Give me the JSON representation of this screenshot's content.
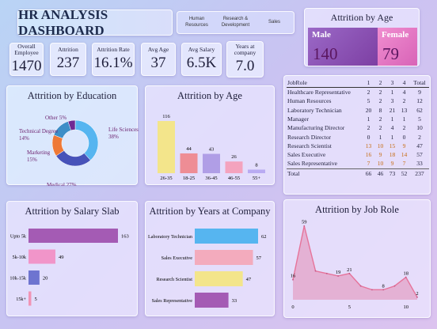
{
  "header": {
    "title": "HR ANALYSIS DASHBOARD",
    "nav": [
      "Human Resources",
      "Research & Development",
      "Sales"
    ]
  },
  "kpis": [
    {
      "label": "Overall Employee",
      "value": "1470"
    },
    {
      "label": "Attrition",
      "value": "237"
    },
    {
      "label": "Attrition Rate",
      "value": "16.1%"
    },
    {
      "label": "Avg Age",
      "value": "37"
    },
    {
      "label": "Avg Salary",
      "value": "6.5K"
    },
    {
      "label": "Years at company",
      "value": "7.0"
    }
  ],
  "gender": {
    "title": "Attrition by Age",
    "male_label": "Male",
    "male_value": "140",
    "female_label": "Female",
    "female_value": "79"
  },
  "colors": {
    "yellow": "#f3e58b",
    "pink": "#f4a3be",
    "lavender": "#b09ee6",
    "blue": "#56b5f0",
    "purple": "#a45bb4",
    "navy": "#4752b9",
    "orange": "#ee7937",
    "teal": "#3d8ec7",
    "violet": "#6f2a94"
  },
  "chart_data": [
    {
      "id": "education",
      "type": "pie",
      "title": "Attrition by Education",
      "categories": [
        "Life Sciences",
        "Medical",
        "Marketing",
        "Technical Degree",
        "Other"
      ],
      "labels": [
        "Life Sciences\n38%",
        "Medical 27%",
        "Marketing\n15%",
        "Technical Degree\n14%",
        "Other 5%"
      ],
      "values": [
        38,
        27,
        15,
        14,
        5
      ]
    },
    {
      "id": "age",
      "type": "bar",
      "title": "Attrition by Age",
      "categories": [
        "26-35",
        "18-25",
        "36-45",
        "46-55",
        "55+"
      ],
      "values": [
        116,
        44,
        43,
        26,
        8
      ]
    },
    {
      "id": "salary",
      "type": "bar",
      "title": "Attrition by Salary Slab",
      "orientation": "horizontal",
      "categories": [
        "Upto 5k",
        "5k-10k",
        "10k-15k",
        "15k+"
      ],
      "values": [
        163,
        49,
        20,
        5
      ]
    },
    {
      "id": "years",
      "type": "bar",
      "title": "Attrition by Years at Company",
      "orientation": "horizontal",
      "categories": [
        "Laboratory Technician",
        "Sales Executive",
        "Research Scientist",
        "Sales Representative"
      ],
      "values": [
        62,
        57,
        47,
        33
      ]
    },
    {
      "id": "jobrole",
      "type": "area",
      "title": "Attrition by Job Role",
      "x": [
        0,
        1,
        2,
        3,
        4,
        5,
        6,
        7,
        8,
        9,
        10,
        11
      ],
      "values": [
        16,
        59,
        23,
        21,
        19,
        21,
        11,
        8,
        8,
        11,
        18,
        2
      ],
      "data_labels": {
        "0": "16",
        "1": "59",
        "4": "19",
        "5": "21",
        "8": "8",
        "10": "18",
        "11": "2"
      },
      "x_ticks": [
        0,
        5,
        10
      ]
    },
    {
      "id": "jobrole_table",
      "type": "table",
      "columns": [
        "JobRole",
        "1",
        "2",
        "3",
        "4",
        "Total"
      ],
      "rows": [
        [
          "Healthcare Representative",
          "2",
          "2",
          "1",
          "4",
          "9"
        ],
        [
          "Human Resources",
          "5",
          "2",
          "3",
          "2",
          "12"
        ],
        [
          "Laboratory Technician",
          "20",
          "8",
          "21",
          "13",
          "62"
        ],
        [
          "Manager",
          "1",
          "2",
          "1",
          "1",
          "5"
        ],
        [
          "Manufacturing Director",
          "2",
          "2",
          "4",
          "2",
          "10"
        ],
        [
          "Research Director",
          "0",
          "1",
          "1",
          "0",
          "2"
        ],
        [
          "Research Scientist",
          "13",
          "10",
          "15",
          "9",
          "47"
        ],
        [
          "Sales Executive",
          "16",
          "9",
          "18",
          "14",
          "57"
        ],
        [
          "Sales Representative",
          "7",
          "10",
          "9",
          "7",
          "33"
        ],
        [
          "Total",
          "66",
          "46",
          "73",
          "52",
          "237"
        ]
      ],
      "highlight_rows": [
        6,
        7,
        8
      ]
    }
  ]
}
